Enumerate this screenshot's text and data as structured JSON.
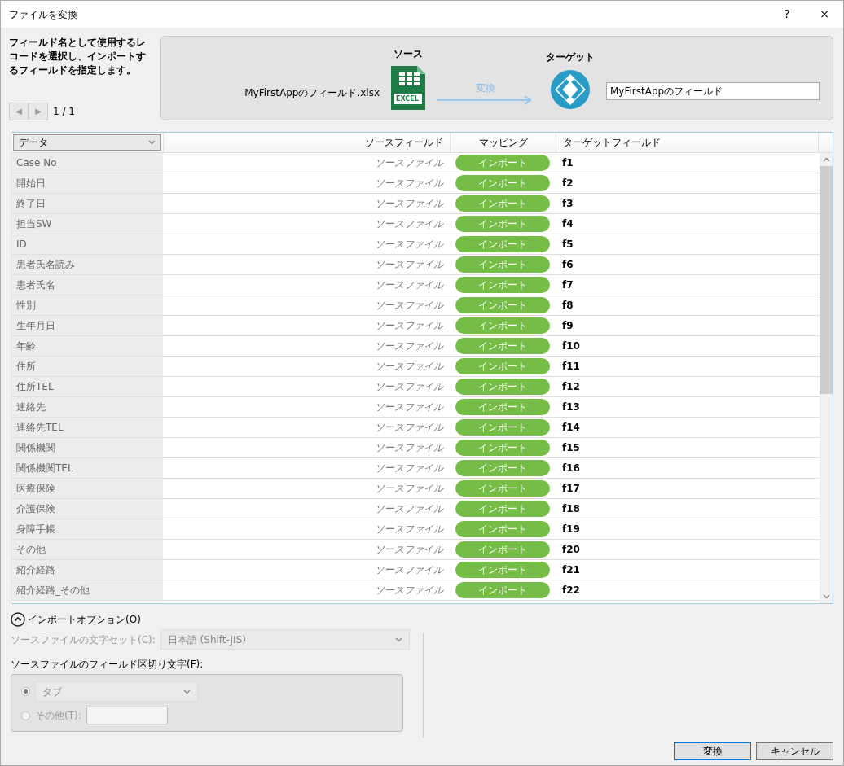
{
  "window": {
    "title": "ファイルを変換",
    "help": "?",
    "close": "×"
  },
  "instructions": "フィールド名として使用するレコードを選択し、インポートするフィールドを指定します。",
  "record_nav": {
    "prev": "◀",
    "next": "▶",
    "page": "1 / 1"
  },
  "source": {
    "heading": "ソース",
    "file": "MyFirstAppのフィールド.xlsx",
    "icon_label": "EXCEL"
  },
  "arrow_label": "変換",
  "target": {
    "heading": "ターゲット",
    "name": "MyFirstAppのフィールド"
  },
  "table": {
    "record_select": "データ",
    "columns": [
      "ソースフィールド",
      "マッピング",
      "ターゲットフィールド"
    ],
    "rows": [
      {
        "name": "Case No",
        "source": "ソースファイル",
        "mapping": "インポート",
        "target": "f1"
      },
      {
        "name": "開始日",
        "source": "ソースファイル",
        "mapping": "インポート",
        "target": "f2"
      },
      {
        "name": "終了日",
        "source": "ソースファイル",
        "mapping": "インポート",
        "target": "f3"
      },
      {
        "name": "担当SW",
        "source": "ソースファイル",
        "mapping": "インポート",
        "target": "f4"
      },
      {
        "name": "ID",
        "source": "ソースファイル",
        "mapping": "インポート",
        "target": "f5"
      },
      {
        "name": "患者氏名読み",
        "source": "ソースファイル",
        "mapping": "インポート",
        "target": "f6"
      },
      {
        "name": "患者氏名",
        "source": "ソースファイル",
        "mapping": "インポート",
        "target": "f7"
      },
      {
        "name": "性別",
        "source": "ソースファイル",
        "mapping": "インポート",
        "target": "f8"
      },
      {
        "name": "生年月日",
        "source": "ソースファイル",
        "mapping": "インポート",
        "target": "f9"
      },
      {
        "name": "年齢",
        "source": "ソースファイル",
        "mapping": "インポート",
        "target": "f10"
      },
      {
        "name": "住所",
        "source": "ソースファイル",
        "mapping": "インポート",
        "target": "f11"
      },
      {
        "name": "住所TEL",
        "source": "ソースファイル",
        "mapping": "インポート",
        "target": "f12"
      },
      {
        "name": "連絡先",
        "source": "ソースファイル",
        "mapping": "インポート",
        "target": "f13"
      },
      {
        "name": "連絡先TEL",
        "source": "ソースファイル",
        "mapping": "インポート",
        "target": "f14"
      },
      {
        "name": "関係機関",
        "source": "ソースファイル",
        "mapping": "インポート",
        "target": "f15"
      },
      {
        "name": "関係機関TEL",
        "source": "ソースファイル",
        "mapping": "インポート",
        "target": "f16"
      },
      {
        "name": "医療保険",
        "source": "ソースファイル",
        "mapping": "インポート",
        "target": "f17"
      },
      {
        "name": "介護保険",
        "source": "ソースファイル",
        "mapping": "インポート",
        "target": "f18"
      },
      {
        "name": "身障手帳",
        "source": "ソースファイル",
        "mapping": "インポート",
        "target": "f19"
      },
      {
        "name": "その他",
        "source": "ソースファイル",
        "mapping": "インポート",
        "target": "f20"
      },
      {
        "name": "紹介経路",
        "source": "ソースファイル",
        "mapping": "インポート",
        "target": "f21"
      },
      {
        "name": "紹介経路_その他",
        "source": "ソースファイル",
        "mapping": "インポート",
        "target": "f22"
      }
    ]
  },
  "import_options": {
    "label": "インポートオプション(O)",
    "expanded": true,
    "charset": {
      "label": "ソースファイルの文字セット(C):",
      "value": "日本語 (Shift-JIS)",
      "disabled": true
    },
    "delimiter": {
      "label": "ソースファイルのフィールド区切り文字(F):",
      "disabled": true,
      "options": [
        {
          "kind": "select",
          "label": "タブ",
          "selected": true
        },
        {
          "kind": "text",
          "label": "その他(T):",
          "selected": false
        }
      ]
    }
  },
  "buttons": [
    {
      "label": "変換",
      "default": true
    },
    {
      "label": "キャンセル",
      "default": false
    }
  ]
}
